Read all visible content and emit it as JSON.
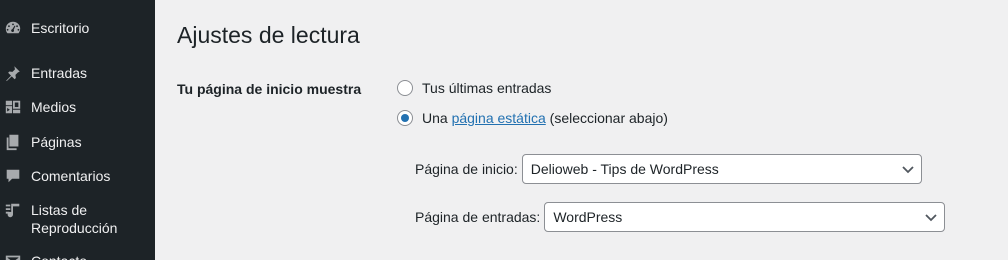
{
  "sidebar": {
    "items": [
      {
        "label": "Escritorio",
        "icon": "dashboard-icon"
      },
      {
        "label": "Entradas",
        "icon": "pin-icon"
      },
      {
        "label": "Medios",
        "icon": "media-icon"
      },
      {
        "label": "Páginas",
        "icon": "pages-icon"
      },
      {
        "label": "Comentarios",
        "icon": "comment-icon"
      },
      {
        "label": "Listas de Reproducción",
        "icon": "playlist-icon"
      },
      {
        "label": "Contacto",
        "icon": "mail-icon"
      }
    ]
  },
  "page": {
    "title": "Ajustes de lectura",
    "front_page_label": "Tu página de inicio muestra",
    "options": {
      "latest": {
        "label": "Tus últimas entradas",
        "checked": false
      },
      "static": {
        "prefix": "Una",
        "link": "página estática",
        "suffix": "(seleccionar abajo)",
        "checked": true
      }
    },
    "homepage": {
      "label": "Página de inicio:",
      "value": "Delioweb - Tips de WordPress"
    },
    "postspage": {
      "label": "Página de entradas:",
      "value": "WordPress"
    }
  },
  "colors": {
    "sidebar_bg": "#1d2327",
    "accent": "#2271b1",
    "page_bg": "#f0f0f1"
  }
}
